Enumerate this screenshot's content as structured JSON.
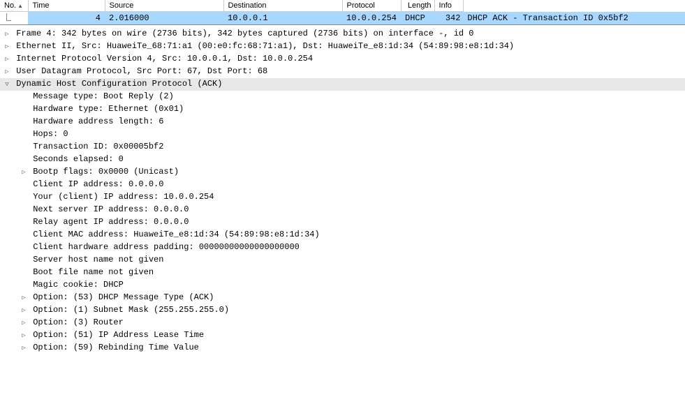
{
  "columns": {
    "no": "No.",
    "time": "Time",
    "source": "Source",
    "destination": "Destination",
    "protocol": "Protocol",
    "length": "Length",
    "info": "Info"
  },
  "packet": {
    "no": "4",
    "time": "2.016000",
    "source": "10.0.0.1",
    "destination": "10.0.0.254",
    "protocol": "DHCP",
    "length": "342",
    "info": "DHCP ACK      - Transaction ID 0x5bf2"
  },
  "details": {
    "frame": "Frame 4: 342 bytes on wire (2736 bits), 342 bytes captured (2736 bits) on interface -, id 0",
    "eth": "Ethernet II, Src: HuaweiTe_68:71:a1 (00:e0:fc:68:71:a1), Dst: HuaweiTe_e8:1d:34 (54:89:98:e8:1d:34)",
    "ip": "Internet Protocol Version 4, Src: 10.0.0.1, Dst: 10.0.0.254",
    "udp": "User Datagram Protocol, Src Port: 67, Dst Port: 68",
    "dhcp_header": "Dynamic Host Configuration Protocol (ACK)",
    "msg_type": "Message type: Boot Reply (2)",
    "hw_type": "Hardware type: Ethernet (0x01)",
    "hw_addr_len": "Hardware address length: 6",
    "hops": "Hops: 0",
    "trans_id": "Transaction ID: 0x00005bf2",
    "seconds": "Seconds elapsed: 0",
    "bootp_flags": "Bootp flags: 0x0000 (Unicast)",
    "client_ip": "Client IP address: 0.0.0.0",
    "your_ip": "Your (client) IP address: 10.0.0.254",
    "next_srv": "Next server IP address: 0.0.0.0",
    "relay": "Relay agent IP address: 0.0.0.0",
    "client_mac": "Client MAC address: HuaweiTe_e8:1d:34 (54:89:98:e8:1d:34)",
    "padding": "Client hardware address padding: 00000000000000000000",
    "host_name": "Server host name not given",
    "boot_file": "Boot file name not given",
    "magic": "Magic cookie: DHCP",
    "opt53": "Option: (53) DHCP Message Type (ACK)",
    "opt1": "Option: (1) Subnet Mask (255.255.255.0)",
    "opt3": "Option: (3) Router",
    "opt51": "Option: (51) IP Address Lease Time",
    "opt59": "Option: (59) Rebinding Time Value"
  }
}
